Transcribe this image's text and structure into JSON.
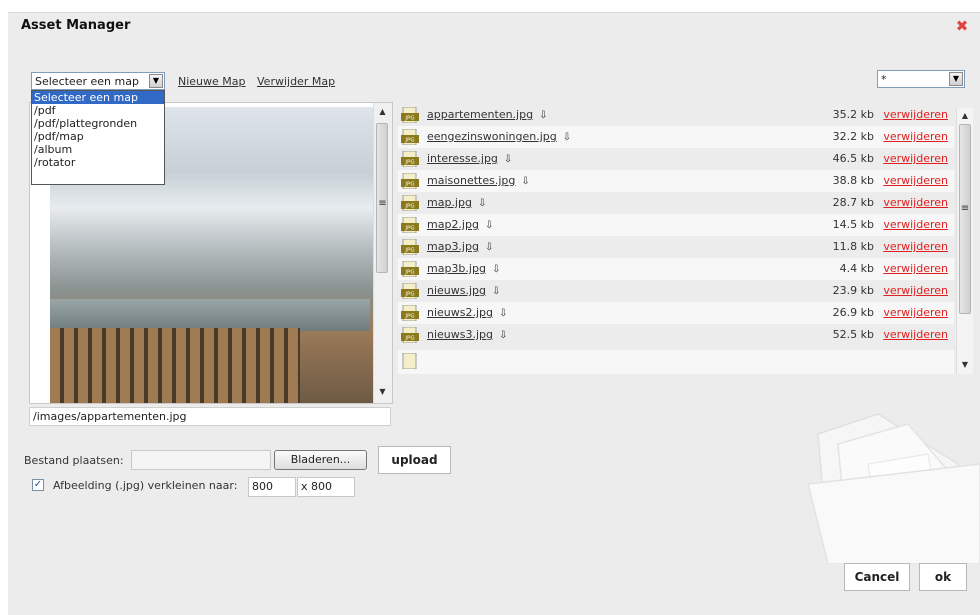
{
  "dialog": {
    "title": "Asset Manager",
    "close_icon": "close-x-icon"
  },
  "toolbar": {
    "folder_select": {
      "selected": "Selecteer een map"
    },
    "new_folder": "Nieuwe Map",
    "delete_folder": "Verwijder Map",
    "filter_select": {
      "selected": "*"
    }
  },
  "folder_dropdown": {
    "options": [
      "Selecteer een map",
      "/pdf",
      "/pdf/plattegronden",
      "/pdf/map",
      "/album",
      "/rotator"
    ]
  },
  "preview": {
    "path": "/images/appartementen.jpg"
  },
  "files": [
    {
      "name": "appartementen.jpg",
      "size": "35.2 kb",
      "action": "verwijderen"
    },
    {
      "name": "eengezinswoningen.jpg",
      "size": "32.2 kb",
      "action": "verwijderen"
    },
    {
      "name": "interesse.jpg",
      "size": "46.5 kb",
      "action": "verwijderen"
    },
    {
      "name": "maisonettes.jpg",
      "size": "38.8 kb",
      "action": "verwijderen"
    },
    {
      "name": "map.jpg",
      "size": "28.7 kb",
      "action": "verwijderen"
    },
    {
      "name": "map2.jpg",
      "size": "14.5 kb",
      "action": "verwijderen"
    },
    {
      "name": "map3.jpg",
      "size": "11.8 kb",
      "action": "verwijderen"
    },
    {
      "name": "map3b.jpg",
      "size": "4.4 kb",
      "action": "verwijderen"
    },
    {
      "name": "nieuws.jpg",
      "size": "23.9 kb",
      "action": "verwijderen"
    },
    {
      "name": "nieuws2.jpg",
      "size": "26.9 kb",
      "action": "verwijderen"
    },
    {
      "name": "nieuws3.jpg",
      "size": "52.5 kb",
      "action": "verwijderen"
    }
  ],
  "upload": {
    "label": "Bestand plaatsen:",
    "browse": "Bladeren...",
    "upload_button": "upload",
    "resize_checked": true,
    "resize_label": "Afbeelding (.jpg) verkleinen naar:",
    "width": "800",
    "height_label": "x 800"
  },
  "footer": {
    "cancel": "Cancel",
    "ok": "ok"
  },
  "colors": {
    "dialog_bg": "#ececec",
    "link_red": "#e02020",
    "selection_blue": "#3169c6"
  }
}
